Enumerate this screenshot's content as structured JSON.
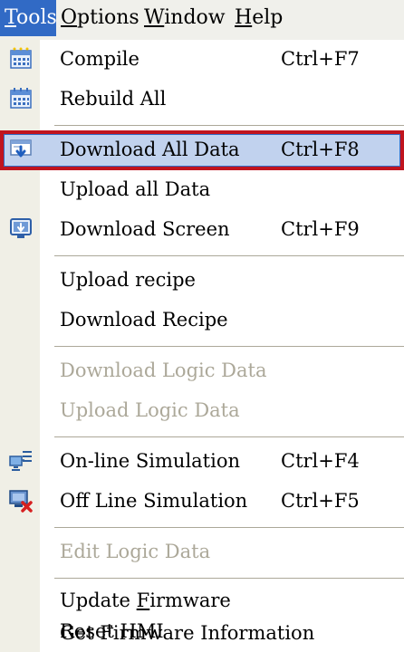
{
  "menubar": {
    "items": [
      {
        "label": "Tools",
        "active": true
      },
      {
        "label": "Options",
        "active": false
      },
      {
        "label": "Window",
        "active": false
      },
      {
        "label": "Help",
        "active": false
      }
    ]
  },
  "tools_menu": {
    "items": [
      {
        "label": "Compile",
        "shortcut": "Ctrl+F7",
        "icon": "compile-icon",
        "enabled": true
      },
      {
        "label": "Rebuild All",
        "shortcut": "",
        "icon": "rebuild-icon",
        "enabled": true
      },
      {
        "label": "Download All Data",
        "shortcut": "Ctrl+F8",
        "icon": "download-all-icon",
        "enabled": true,
        "highlighted": true
      },
      {
        "label": "Upload all Data",
        "shortcut": "",
        "icon": "",
        "enabled": true
      },
      {
        "label": "Download Screen",
        "shortcut": "Ctrl+F9",
        "icon": "download-screen-icon",
        "enabled": true
      },
      {
        "label": "Upload recipe",
        "shortcut": "",
        "icon": "",
        "enabled": true
      },
      {
        "label": "Download Recipe",
        "shortcut": "",
        "icon": "",
        "enabled": true
      },
      {
        "label": "Download Logic Data",
        "shortcut": "",
        "icon": "",
        "enabled": false
      },
      {
        "label": "Upload Logic Data",
        "shortcut": "",
        "icon": "",
        "enabled": false
      },
      {
        "label": "On-line Simulation",
        "shortcut": "Ctrl+F4",
        "icon": "online-simulation-icon",
        "enabled": true
      },
      {
        "label": "Off Line Simulation",
        "shortcut": "Ctrl+F5",
        "icon": "offline-simulation-icon",
        "enabled": true
      },
      {
        "label": "Edit Logic Data",
        "shortcut": "",
        "icon": "",
        "enabled": false
      },
      {
        "label": "Update Firmware",
        "shortcut": "",
        "icon": "",
        "enabled": true
      },
      {
        "label": "Get Firmware Information",
        "shortcut": "",
        "icon": "",
        "enabled": true
      },
      {
        "label": "Reset HMI",
        "shortcut": "",
        "icon": "",
        "enabled": true
      }
    ]
  },
  "colors": {
    "menubar_active": "#316ac5",
    "highlight_fill": "#c1d2ee",
    "highlight_outline": "#c0141e",
    "disabled_text": "#aca899",
    "gutter": "#f0efe6"
  }
}
